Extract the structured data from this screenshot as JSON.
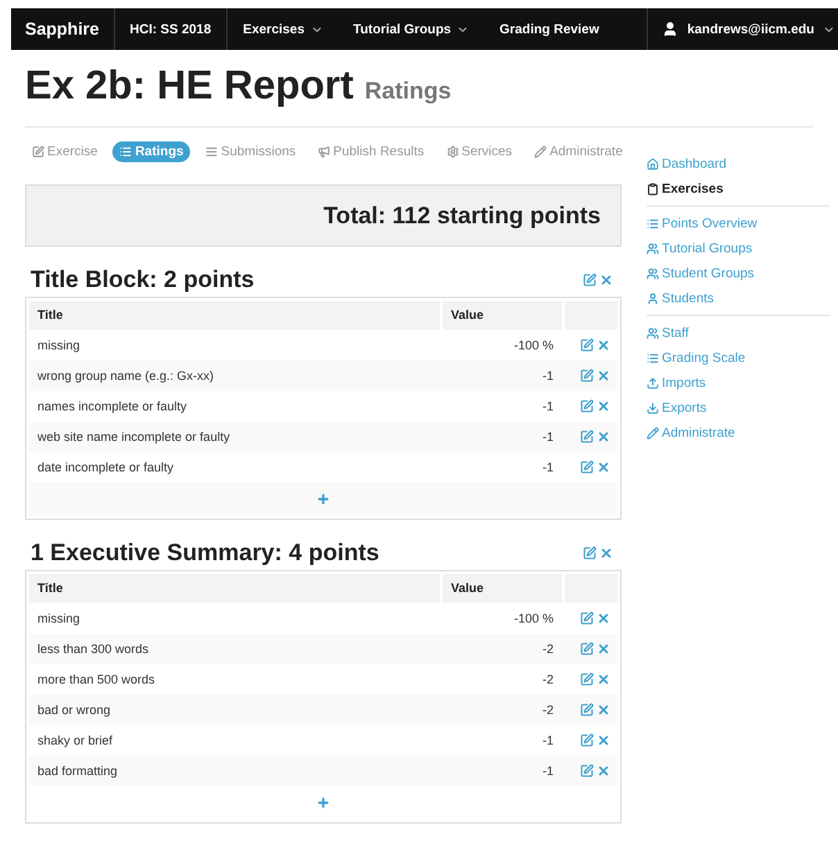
{
  "navbar": {
    "brand": "Sapphire",
    "items": [
      {
        "label": "HCI: SS 2018",
        "dropdown": false
      },
      {
        "label": "Exercises",
        "dropdown": true
      },
      {
        "label": "Tutorial Groups",
        "dropdown": true
      },
      {
        "label": "Grading Review",
        "dropdown": false
      }
    ],
    "user": {
      "label": "kandrews@iicm.edu",
      "dropdown": true
    }
  },
  "page_title": {
    "title": "Ex 2b: HE Report",
    "subtitle": "Ratings"
  },
  "tabs": [
    {
      "label": "Exercise",
      "kind": "edit",
      "selected": false
    },
    {
      "label": "Ratings",
      "kind": "list",
      "selected": true
    },
    {
      "label": "Submissions",
      "kind": "lines",
      "selected": false
    },
    {
      "label": "Publish Results",
      "kind": "megaphone",
      "selected": false
    },
    {
      "label": "Services",
      "kind": "gear",
      "selected": false
    },
    {
      "label": "Administrate",
      "kind": "pencil",
      "selected": false
    }
  ],
  "total": "Total: 112 starting points",
  "groups": [
    {
      "title": "Title Block: 2 points",
      "columns": [
        "Title",
        "Value"
      ],
      "rows": [
        {
          "title": "missing",
          "value": "-100 %"
        },
        {
          "title": "wrong group name (e.g.: Gx-xx)",
          "value": "-1"
        },
        {
          "title": "names incomplete or faulty",
          "value": "-1"
        },
        {
          "title": "web site name incomplete or faulty",
          "value": "-1"
        },
        {
          "title": "date incomplete or faulty",
          "value": "-1"
        }
      ]
    },
    {
      "title": "1 Executive Summary: 4 points",
      "columns": [
        "Title",
        "Value"
      ],
      "rows": [
        {
          "title": "missing",
          "value": "-100 %"
        },
        {
          "title": "less than 300 words",
          "value": "-2"
        },
        {
          "title": "more than 500 words",
          "value": "-2"
        },
        {
          "title": "bad or wrong",
          "value": "-2"
        },
        {
          "title": "shaky or brief",
          "value": "-1"
        },
        {
          "title": "bad formatting",
          "value": "-1"
        }
      ]
    }
  ],
  "sidebar": {
    "sections": [
      [
        {
          "label": "Dashboard",
          "kind": "home",
          "selected": false
        },
        {
          "label": "Exercises",
          "kind": "clipboard",
          "selected": true
        }
      ],
      [
        {
          "label": "Points Overview",
          "kind": "list",
          "selected": false
        },
        {
          "label": "Tutorial Groups",
          "kind": "users",
          "selected": false
        },
        {
          "label": "Student Groups",
          "kind": "users",
          "selected": false
        },
        {
          "label": "Students",
          "kind": "user",
          "selected": false
        }
      ],
      [
        {
          "label": "Staff",
          "kind": "users",
          "selected": false
        },
        {
          "label": "Grading Scale",
          "kind": "list",
          "selected": false
        },
        {
          "label": "Imports",
          "kind": "upload",
          "selected": false
        },
        {
          "label": "Exports",
          "kind": "download",
          "selected": false
        },
        {
          "label": "Administrate",
          "kind": "pencil",
          "selected": false
        }
      ]
    ]
  }
}
